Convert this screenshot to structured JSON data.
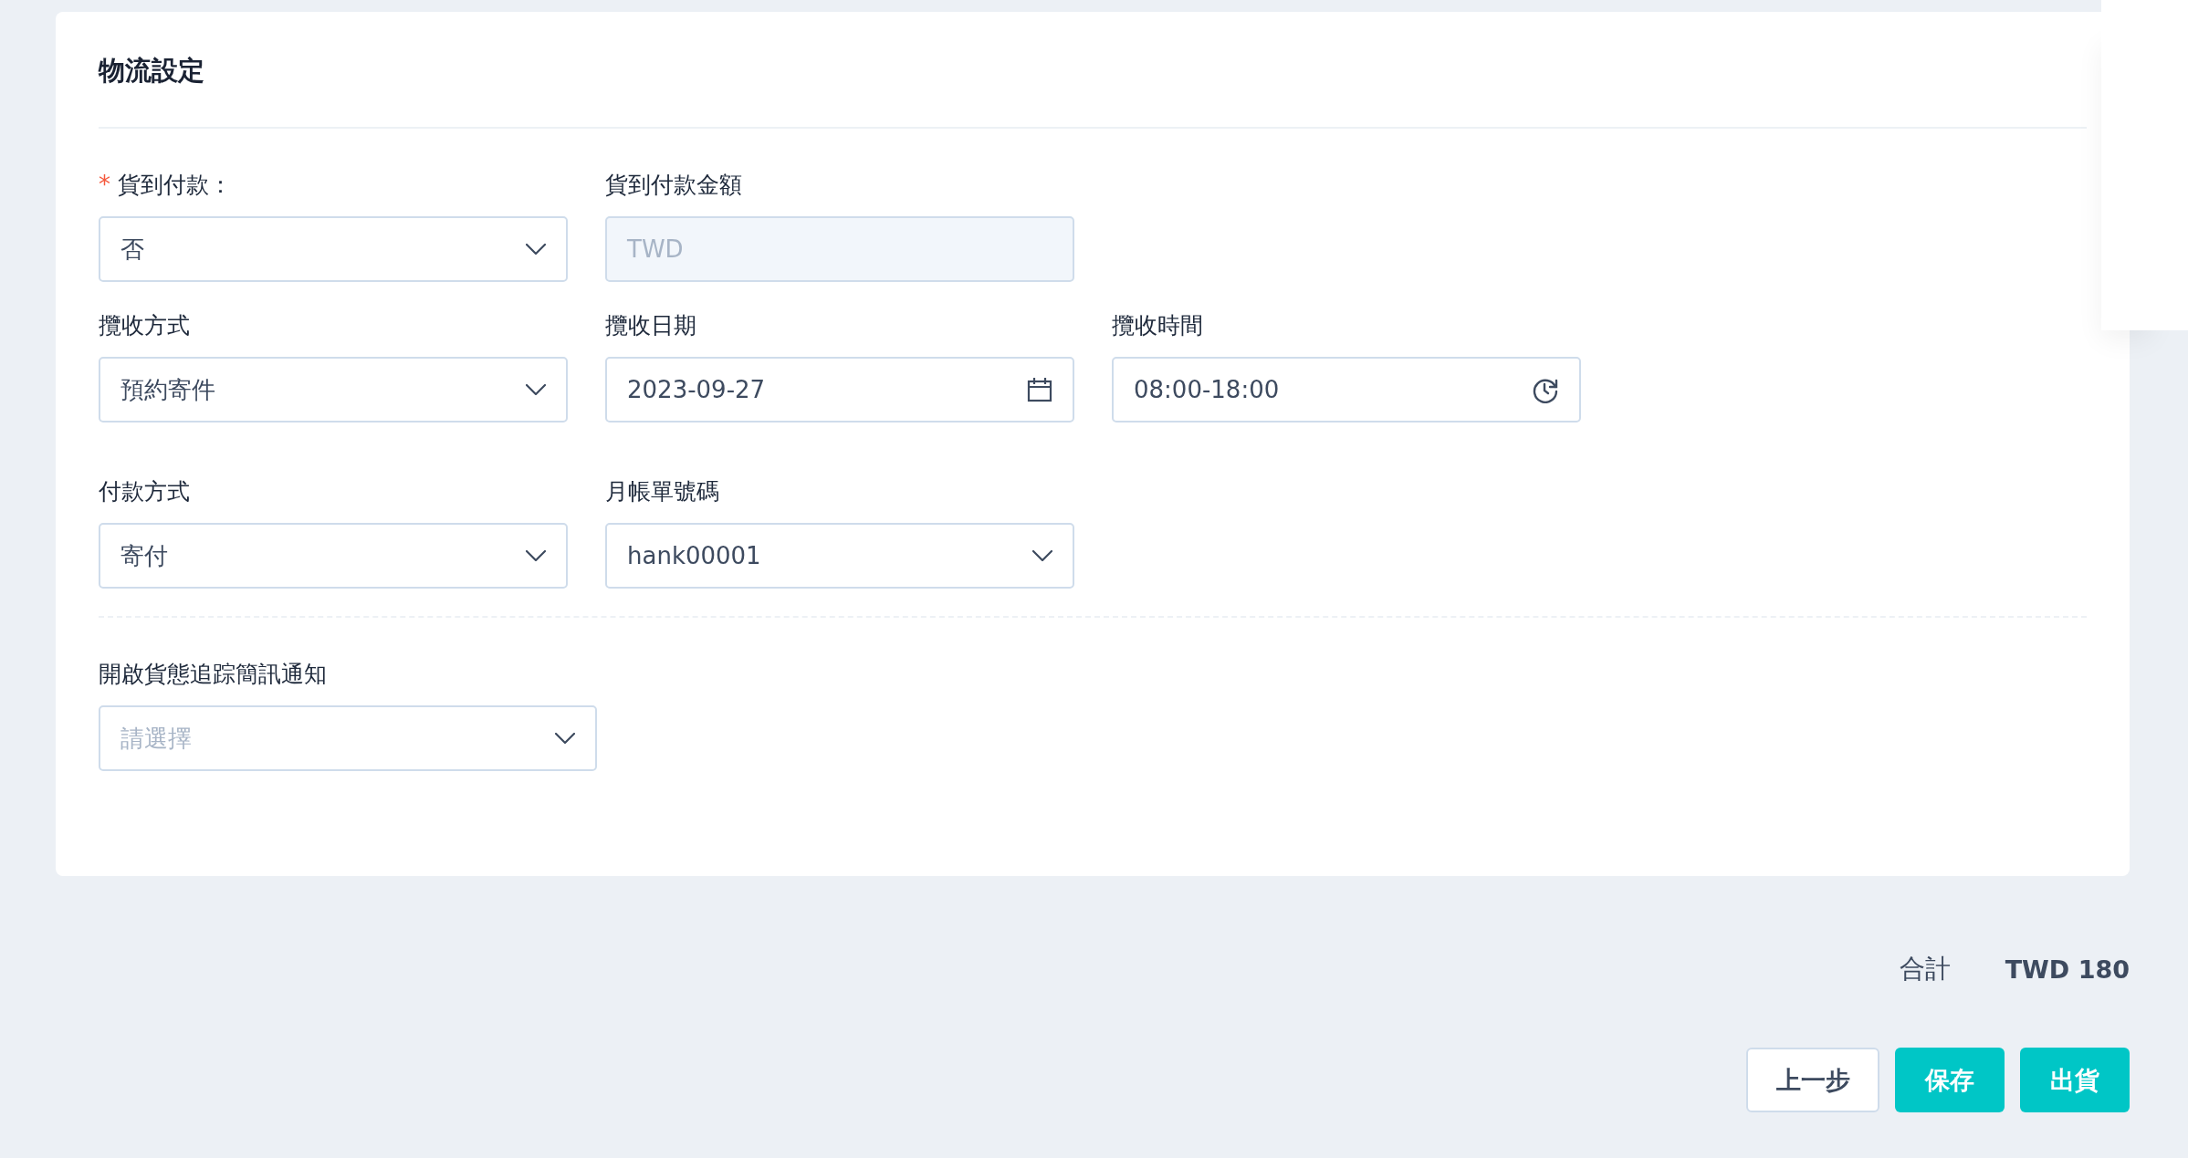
{
  "card": {
    "title": "物流設定",
    "rows": [
      [
        {
          "kind": "select",
          "label": "貨到付款：",
          "required_mark": "*",
          "value": "否"
        },
        {
          "kind": "input",
          "label": "貨到付款金額",
          "disabled": true,
          "placeholder": "TWD"
        }
      ],
      [
        {
          "kind": "select",
          "label": "攬收方式",
          "value": "預約寄件"
        },
        {
          "kind": "date",
          "label": "攬收日期",
          "value": "2023-09-27"
        },
        {
          "kind": "time",
          "label": "攬收時間",
          "value": "08:00-18:00"
        }
      ],
      [
        {
          "kind": "select",
          "label": "付款方式",
          "value": "寄付"
        },
        {
          "kind": "select",
          "label": "月帳單號碼",
          "value": "hank00001"
        }
      ]
    ],
    "notification": {
      "kind": "select",
      "label": "開啟貨態追踪簡訊通知",
      "placeholder": "請選擇"
    }
  },
  "total": {
    "label": "合計",
    "amount": "TWD 180"
  },
  "buttons": [
    {
      "label": "上一步",
      "kind": "secondary"
    },
    {
      "label": "保存",
      "kind": "primary"
    },
    {
      "label": "出貨",
      "kind": "primary"
    }
  ]
}
